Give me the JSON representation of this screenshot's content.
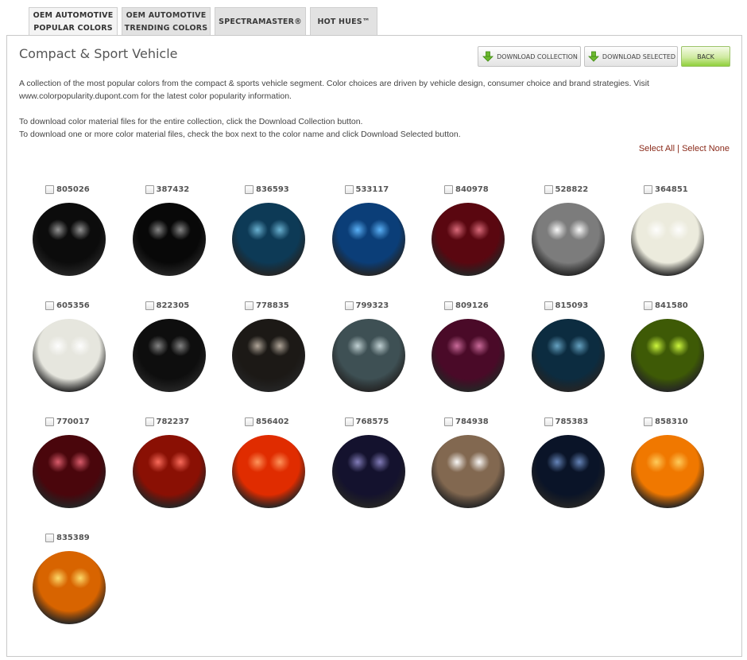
{
  "tabs": [
    {
      "line1": "OEM AUTOMOTIVE",
      "line2": "POPULAR COLORS",
      "active": true
    },
    {
      "line1": "OEM AUTOMOTIVE",
      "line2": "TRENDING COLORS",
      "active": false
    },
    {
      "line1": "SPECTRAMASTER®",
      "line2": "",
      "active": false
    },
    {
      "line1": "HOT HUES™",
      "line2": "",
      "active": false
    }
  ],
  "panel": {
    "title": "Compact & Sport Vehicle",
    "buttons": {
      "download_collection": "DOWNLOAD COLLECTION",
      "download_selected": "DOWNLOAD SELECTED",
      "back": "BACK"
    },
    "description": "A collection of the most popular colors from the compact & sports vehicle segment. Color choices are driven by vehicle design, consumer choice and brand strategies. Visit www.colorpopularity.dupont.com for the latest color popularity information.",
    "instructions_1": "To download color material files for the entire collection, click the Download Collection button.",
    "instructions_2": "To download one or more color material files, check the box next to the color name and click Download Selected button.",
    "select_all": "Select All",
    "select_separator": "|",
    "select_none": "Select None"
  },
  "colors": [
    {
      "code": "805026",
      "base": "#0c0c0c",
      "shine": "#9a9a9a"
    },
    {
      "code": "387432",
      "base": "#080808",
      "shine": "#8c8c8c"
    },
    {
      "code": "836593",
      "base": "#0d3a56",
      "shine": "#6fb8d8"
    },
    {
      "code": "533117",
      "base": "#0b3e78",
      "shine": "#5fb8ff"
    },
    {
      "code": "840978",
      "base": "#5a0710",
      "shine": "#e07080"
    },
    {
      "code": "528822",
      "base": "#7c7c7c",
      "shine": "#ffffff"
    },
    {
      "code": "364851",
      "base": "#ecebdd",
      "shine": "#ffffff"
    },
    {
      "code": "605356",
      "base": "#e6e6de",
      "shine": "#ffffff"
    },
    {
      "code": "822305",
      "base": "#0e0e0e",
      "shine": "#8a8a8a"
    },
    {
      "code": "778835",
      "base": "#1c1916",
      "shine": "#b8ada0"
    },
    {
      "code": "799323",
      "base": "#3e5054",
      "shine": "#c8d8da"
    },
    {
      "code": "809126",
      "base": "#4a0a28",
      "shine": "#d070a0"
    },
    {
      "code": "815093",
      "base": "#0c2c40",
      "shine": "#6aa8c8"
    },
    {
      "code": "841580",
      "base": "#3e5a06",
      "shine": "#d4ff40"
    },
    {
      "code": "770017",
      "base": "#4a060c",
      "shine": "#e06070"
    },
    {
      "code": "782237",
      "base": "#8a1004",
      "shine": "#ff7060"
    },
    {
      "code": "856402",
      "base": "#e02c00",
      "shine": "#ff9a60"
    },
    {
      "code": "768575",
      "base": "#14122e",
      "shine": "#8882c0"
    },
    {
      "code": "784938",
      "base": "#826850",
      "shine": "#ffffff"
    },
    {
      "code": "785383",
      "base": "#0a1428",
      "shine": "#6a8ac0"
    },
    {
      "code": "858310",
      "base": "#f07800",
      "shine": "#ffd060"
    },
    {
      "code": "835389",
      "base": "#d86400",
      "shine": "#ffe070"
    }
  ]
}
